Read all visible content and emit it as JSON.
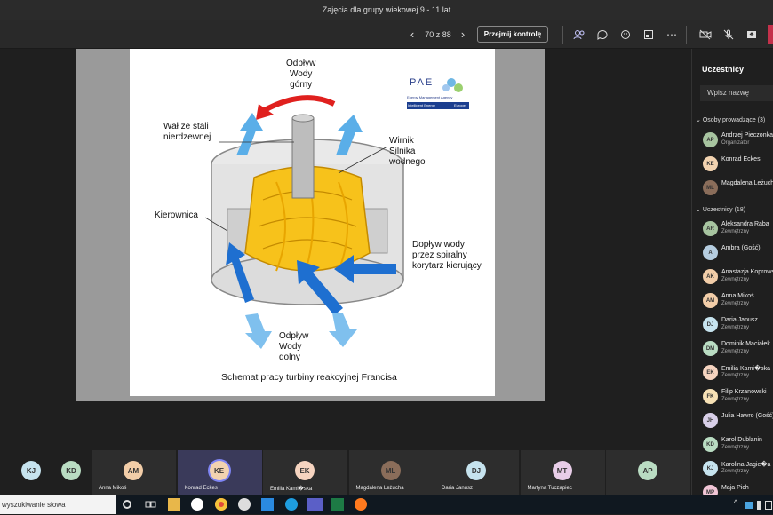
{
  "window": {
    "title": "Zajęcia dla grupy wiekowej 9 - 11 lat"
  },
  "toolbar": {
    "page_counter": "70 z 88",
    "take_control_label": "Przejmij kontrolę"
  },
  "slide": {
    "logo_text": "PAE",
    "logo_subtitle": "Energy Management Agency",
    "logo_band_left": "Intelligent Energy",
    "logo_band_right": "Europe",
    "label_top": "Odpływ\nWody\ngórny",
    "label_shaft": "Wał ze stali\nnierdzewnej",
    "label_runner": "Wirnik\nSilnika\nwodnego",
    "label_guide": "Kierownica",
    "label_inflow": "Dopływ wody\nprzez spiralny\nkorytarz kierujący",
    "label_bottom": "Odpływ\nWody\ndolny",
    "caption": "Schemat pracy turbiny reakcyjnej Francisa"
  },
  "participants_panel": {
    "title": "Uczestnicy",
    "search_placeholder": "Wpisz nazwę",
    "presenters_header": "Osoby prowadzące (3)",
    "attendees_header": "Uczestnicy (18)",
    "presenters": [
      {
        "initials": "AP",
        "name": "Andrzej Pieczonka",
        "sub": "Organizator",
        "color": "#a7c4a0"
      },
      {
        "initials": "KE",
        "name": "Konrad Eckes",
        "sub": "",
        "color": "#f2d3b0"
      },
      {
        "initials": "ML",
        "name": "Magdalena Leżucha",
        "sub": "",
        "color": "#8a6d5a"
      }
    ],
    "attendees": [
      {
        "initials": "AR",
        "name": "Aleksandra Raba",
        "sub": "Zewnętrzny",
        "color": "#a7c4a0"
      },
      {
        "initials": "A",
        "name": "Ambra (Gość)",
        "sub": "",
        "color": "#b5cde0"
      },
      {
        "initials": "AK",
        "name": "Anastazja Koprowska",
        "sub": "Zewnętrzny",
        "color": "#f2cda8"
      },
      {
        "initials": "AM",
        "name": "Anna Mikoś",
        "sub": "Zewnętrzny",
        "color": "#f2cda8"
      },
      {
        "initials": "DJ",
        "name": "Daria Janusz",
        "sub": "Zewnętrzny",
        "color": "#c6e3ee"
      },
      {
        "initials": "DM",
        "name": "Dominik Maciałek",
        "sub": "Zewnętrzny",
        "color": "#b9dcc2"
      },
      {
        "initials": "EK",
        "name": "Emilia Kami�ska",
        "sub": "Zewnętrzny",
        "color": "#f6d4c0"
      },
      {
        "initials": "FK",
        "name": "Filip Krzanowski",
        "sub": "Zewnętrzny",
        "color": "#f7e1b5"
      },
      {
        "initials": "JH",
        "name": "Julia Hawro (Gość)",
        "sub": "",
        "color": "#d8cfe8"
      },
      {
        "initials": "KD",
        "name": "Karol Dublanin",
        "sub": "Zewnętrzny",
        "color": "#b9dcc2"
      },
      {
        "initials": "KJ",
        "name": "Karolina Jagie�a",
        "sub": "Zewnętrzny",
        "color": "#c6e3ee"
      },
      {
        "initials": "MP",
        "name": "Maja Pich",
        "sub": "",
        "color": "#f2c6d6"
      }
    ]
  },
  "gallery": {
    "left_tiles": [
      {
        "initials": "KJ",
        "color": "#c6e3ee"
      },
      {
        "initials": "KD",
        "color": "#b9dcc2"
      }
    ],
    "tiles": [
      {
        "initials": "AM",
        "name": "Anna Mikoś",
        "color": "#f2cda8"
      },
      {
        "initials": "KE",
        "name": "Konrad Eckes",
        "color": "#f2d3b0"
      },
      {
        "initials": "EK",
        "name": "Emilia Kami�ska",
        "color": "#f6d4c0"
      },
      {
        "initials": "ML",
        "name": "Magdalena Leżucha",
        "color": "#8a6d5a"
      },
      {
        "initials": "DJ",
        "name": "Daria Janusz",
        "color": "#c6e3ee"
      },
      {
        "initials": "MT",
        "name": "Martyna Tuczapiec",
        "color": "#e8cde8"
      },
      {
        "initials": "AP",
        "name": "",
        "color": "#b9dcc2"
      }
    ]
  },
  "taskbar": {
    "search_text": "wyszukiwanie słowa"
  }
}
